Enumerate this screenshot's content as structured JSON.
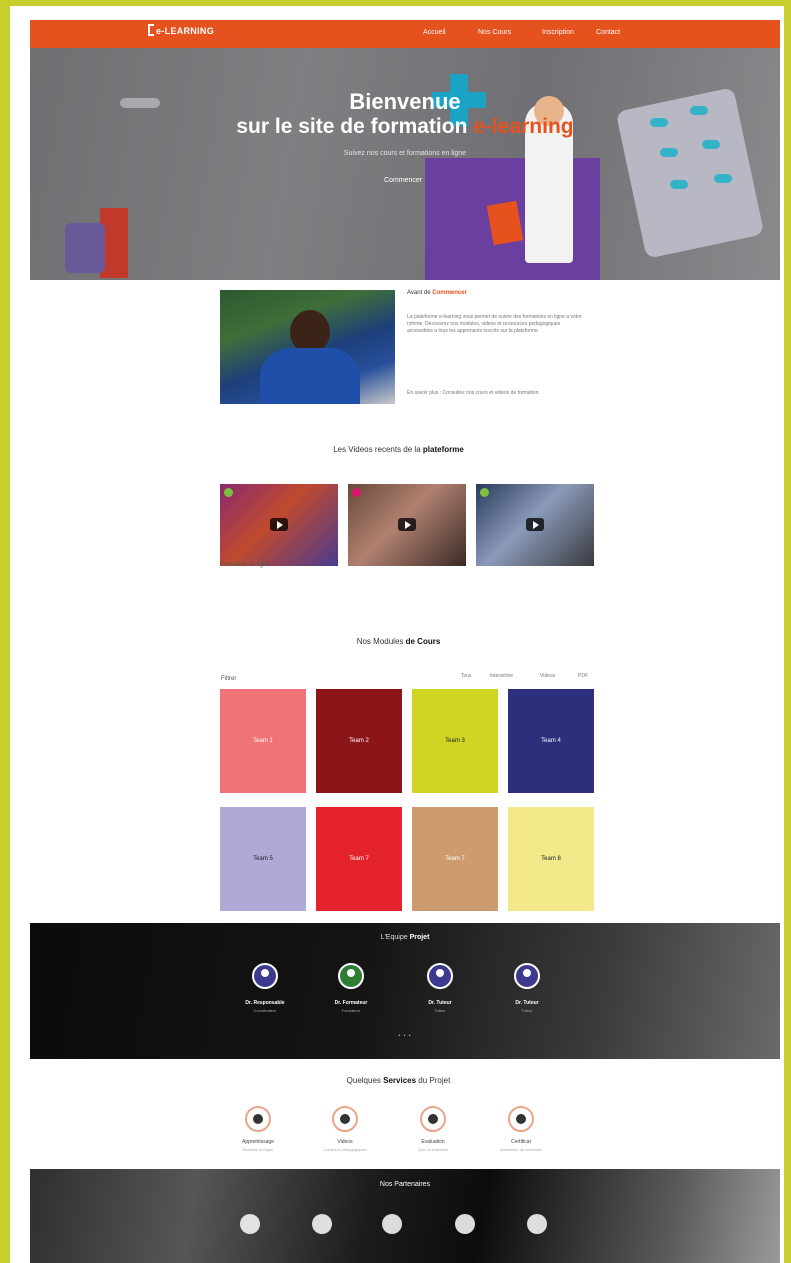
{
  "nav": {
    "logo": "e-LEARNING",
    "links": [
      "Accueil",
      "Nos Cours",
      "Inscription",
      "Contact"
    ],
    "accent_color": "#e6521e"
  },
  "hero": {
    "line1": "Bienvenue",
    "line2_prefix": "sur le site de formation",
    "line2_accent": "e-learning",
    "subtitle": "Suivez nos cours et formations en ligne",
    "cta": "Commencer"
  },
  "about": {
    "title_prefix": "Avant de",
    "title_accent": "Commencer",
    "paragraph1": "La plateforme e-learning vous permet de suivre des formations en ligne a votre rythme. Decouvrez nos modules, videos et ressources pedagogiques accessibles a tous les apprenants inscrits sur la plateforme.",
    "paragraph2": "En savoir plus : Consultez nos cours et videos de formation."
  },
  "videos": {
    "title_prefix": "Les Videos recents de la",
    "title_accent": "plateforme",
    "caption": "Formation en ligne",
    "badge_colors": [
      "#7cc142",
      "#d6156b",
      "#7cc142"
    ]
  },
  "courses": {
    "title_prefix": "Nos Modules",
    "title_accent": "de Cours",
    "filter_label": "Filtrer",
    "filter_tabs": [
      "Tous",
      "Interactive",
      "Videos",
      "PDF"
    ],
    "tiles": [
      {
        "label": "Team 1",
        "color": "#f07476",
        "text_color": "#ffffff"
      },
      {
        "label": "Team 2",
        "color": "#8b1519",
        "text_color": "#ffffff"
      },
      {
        "label": "Team 3",
        "color": "#d0d524",
        "text_color": "#222222"
      },
      {
        "label": "Team 4",
        "color": "#2b2f7c",
        "text_color": "#ffffff"
      },
      {
        "label": "Team 5",
        "color": "#b0a8d7",
        "text_color": "#222222"
      },
      {
        "label": "Team 7",
        "color": "#e5232c",
        "text_color": "#ffffff"
      },
      {
        "label": "Team 7",
        "color": "#cc9c6e",
        "text_color": "#ffffff"
      },
      {
        "label": "Team 8",
        "color": "#f3e98b",
        "text_color": "#222222"
      }
    ]
  },
  "team": {
    "title_prefix": "L'Equipe",
    "title_accent": "Projet",
    "members": [
      {
        "name": "Dr. Responsable",
        "role": "Coordinateur",
        "color": "#3b3a8f"
      },
      {
        "name": "Dr. Formateur",
        "role": "Formateur",
        "color": "#2e7d32"
      },
      {
        "name": "Dr. Tuteur",
        "role": "Tuteur",
        "color": "#3b3a8f"
      },
      {
        "name": "Dr. Tuteur",
        "role": "Tuteur",
        "color": "#3b3a8f"
      }
    ],
    "pager": "• • •"
  },
  "services": {
    "title_prefix": "Quelques",
    "title_accent": "Services",
    "title_suffix": "du Projet",
    "items": [
      {
        "name": "Apprentissage",
        "desc": "Modules en ligne"
      },
      {
        "name": "Videos",
        "desc": "Contenus pedagogiques"
      },
      {
        "name": "Evaluation",
        "desc": "Quiz et examens"
      },
      {
        "name": "Certificat",
        "desc": "Attestation de formation"
      }
    ]
  },
  "partners": {
    "title": "Nos Partenaires",
    "logos": [
      "partner-logo-1",
      "partner-logo-2",
      "partner-logo-3",
      "partner-logo-4",
      "partner-logo-5"
    ]
  }
}
